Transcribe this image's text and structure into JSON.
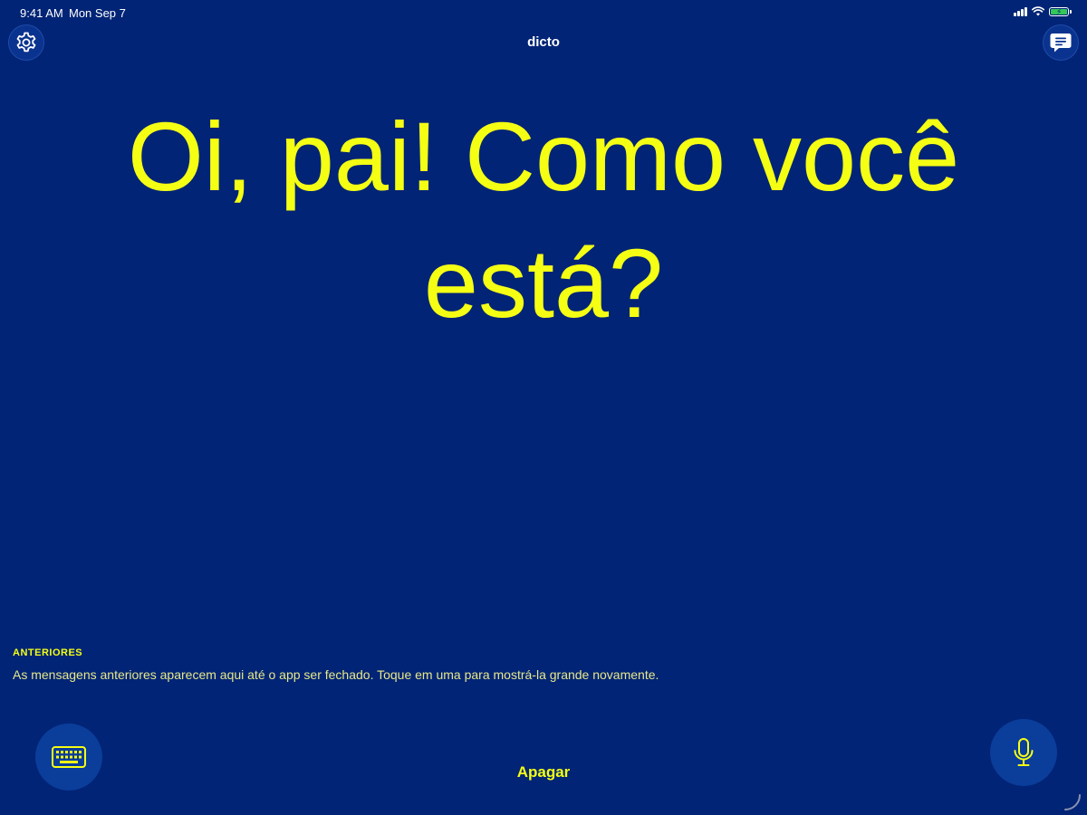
{
  "status_bar": {
    "time": "9:41 AM",
    "date": "Mon Sep 7"
  },
  "header": {
    "title": "dicto"
  },
  "main": {
    "message": "Oi, pai! Como você está?"
  },
  "history": {
    "heading": "ANTERIORES",
    "description": "As mensagens anteriores aparecem aqui até o app ser fechado. Toque em uma para mostrá-la grande novamente."
  },
  "footer": {
    "clear_label": "Apagar"
  },
  "icons": {
    "settings": "gear-icon",
    "messages": "message-bubble-icon",
    "keyboard": "keyboard-icon",
    "microphone": "microphone-icon"
  },
  "colors": {
    "background": "#012476",
    "accent": "#f5ff14",
    "button": "#0b3d9a"
  }
}
